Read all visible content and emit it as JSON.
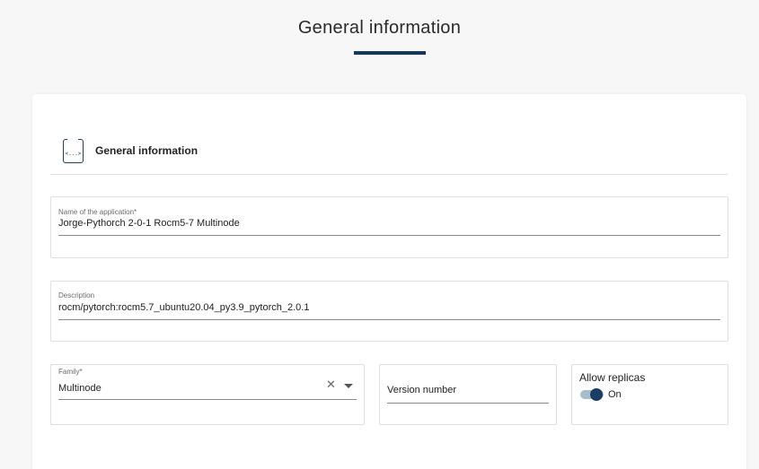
{
  "page": {
    "title": "General information"
  },
  "section": {
    "title": "General information",
    "icon": "code-file-icon",
    "icon_glyph": "<...>"
  },
  "form": {
    "app_name": {
      "label": "Name of the application*",
      "value": "Jorge-Pythorch 2-0-1 Rocm5-7 Multinode"
    },
    "description": {
      "label": "Description",
      "value": "rocm/pytorch:rocm5.7_ubuntu20.04_py3.9_pytorch_2.0.1"
    },
    "family": {
      "label": "Family*",
      "value": "Multinode",
      "clear_glyph": "✕"
    },
    "version": {
      "placeholder": "Version number"
    },
    "replicas": {
      "label": "Allow replicas",
      "state": "On",
      "enabled": true
    }
  },
  "colors": {
    "accent": "#17375e",
    "toggle_track": "#a9bccd",
    "background": "#f7f7f8"
  }
}
